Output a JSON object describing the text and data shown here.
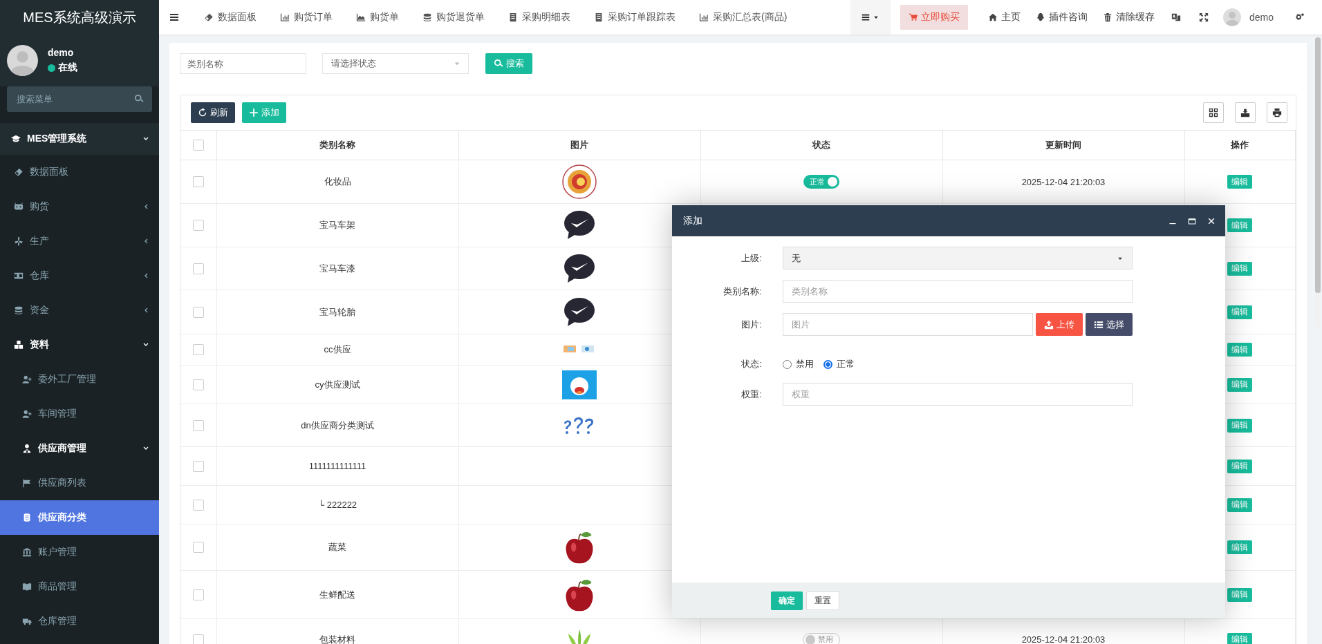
{
  "app": {
    "title": "MES系统高级演示"
  },
  "topbar": {
    "tabs": [
      "数据面板",
      "购货订单",
      "购货单",
      "购货退货单",
      "采购明细表",
      "采购订单跟踪表",
      "采购汇总表(商品)"
    ],
    "buy_button": "立即购买",
    "links": [
      "主页",
      "插件咨询",
      "清除缓存"
    ],
    "user": "demo"
  },
  "sidebar": {
    "user": {
      "name": "demo",
      "status": "在线",
      "online": true
    },
    "search": {
      "placeholder": "搜索菜单"
    },
    "menu": [
      {
        "label": "MES管理系统",
        "expanded": true,
        "selected": false,
        "children": [
          {
            "label": "数据面板",
            "selected": false
          },
          {
            "label": "购货",
            "expanded": false,
            "selected": false
          },
          {
            "label": "生产",
            "expanded": false,
            "selected": false
          },
          {
            "label": "仓库",
            "expanded": false,
            "selected": false
          },
          {
            "label": "资金",
            "expanded": false,
            "selected": false
          },
          {
            "label": "资料",
            "expanded": true,
            "selected": false,
            "children": [
              {
                "label": "委外工厂管理",
                "selected": false
              },
              {
                "label": "车间管理",
                "selected": false
              },
              {
                "label": "供应商管理",
                "expanded": true,
                "selected": false,
                "children": [
                  {
                    "label": "供应商列表",
                    "selected": false
                  },
                  {
                    "label": "供应商分类",
                    "selected": true
                  }
                ]
              },
              {
                "label": "账户管理",
                "selected": false
              },
              {
                "label": "商品管理",
                "selected": false
              },
              {
                "label": "仓库管理",
                "selected": false
              }
            ]
          }
        ]
      }
    ]
  },
  "filters": {
    "name": {
      "placeholder": "类别名称"
    },
    "status": {
      "placeholder": "请选择状态"
    },
    "search_button": "搜索"
  },
  "toolbar": {
    "refresh": "刷新",
    "add": "添加"
  },
  "table": {
    "select_all": {
      "checked": false
    },
    "columns": [
      "类别名称",
      "图片",
      "状态",
      "更新时间",
      "操作"
    ],
    "rows": [
      {
        "name": "化妆品",
        "status": {
          "label": "正常",
          "on": true
        },
        "updated": "2025-12-04 21:20:03",
        "action": "编辑",
        "checked": false
      },
      {
        "name": "宝马车架",
        "action": "编辑",
        "checked": false
      },
      {
        "name": "宝马车漆",
        "action": "编辑",
        "checked": false
      },
      {
        "name": "宝马轮胎",
        "action": "编辑",
        "checked": false
      },
      {
        "name": "cc供应",
        "action": "编辑",
        "checked": false
      },
      {
        "name": "cy供应测试",
        "action": "编辑",
        "checked": false
      },
      {
        "name": "dn供应商分类测试",
        "action": "编辑",
        "checked": false
      },
      {
        "name": "1111111111111",
        "action": "编辑",
        "checked": false
      },
      {
        "name": "└ 222222",
        "action": "编辑",
        "checked": false
      },
      {
        "name": "蔬菜",
        "action": "编辑",
        "checked": false
      },
      {
        "name": "生鲜配送",
        "action": "编辑",
        "checked": false
      },
      {
        "name": "包装材料",
        "status": {
          "label": "禁用",
          "on": false
        },
        "updated": "2025-12-04 21:20:03",
        "action": "编辑",
        "checked": false
      }
    ]
  },
  "dialog": {
    "title": "添加",
    "fields": [
      {
        "kind": "select",
        "label": "上级:",
        "value": "无"
      },
      {
        "kind": "input",
        "label": "类别名称:",
        "placeholder": "类别名称"
      },
      {
        "kind": "upload",
        "label": "图片:",
        "placeholder": "图片",
        "upload": "上传",
        "choose": "选择"
      },
      {
        "kind": "radio",
        "label": "状态:",
        "options": [
          {
            "label": "禁用",
            "selected": false
          },
          {
            "label": "正常",
            "selected": true
          }
        ]
      },
      {
        "kind": "input",
        "label": "权重:",
        "placeholder": "权重"
      }
    ],
    "buttons": [
      {
        "label": "确定",
        "kind": "primary"
      },
      {
        "label": "重置",
        "kind": "default"
      }
    ]
  }
}
